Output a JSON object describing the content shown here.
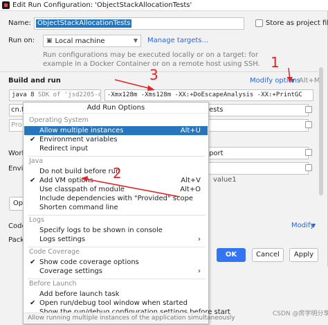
{
  "window": {
    "title": "Edit Run Configuration: 'ObjectStackAllocationTests'",
    "name_label": "Name:",
    "name_value": "ObjectStackAllocationTests",
    "store_label": "Store as project file",
    "run_on_label": "Run on:",
    "run_on_value": "Local machine",
    "manage_targets": "Manage targets...",
    "hint_line1": "Run configurations may be executed locally or on a target: for",
    "hint_line2": "example in a Docker Container or on a remote host using SSH.",
    "build_and_run": "Build and run",
    "modify_options": "Modify options",
    "modify_shortcut": "Alt+M",
    "jre_value": "java 8",
    "jre_grey": " SDK of 'jsd2205-c",
    "vm_options_value": "-Xmx128m -Xms128m -XX:+DoEscapeAnalysis -XX:+PrintGC",
    "main_class_prefix": "cn.t",
    "main_class_tail": "ests",
    "prog_args_prefix": "Pro",
    "working_dir_prefix": "Worki",
    "working_dir_tail": "port",
    "env_prefix": "Envir",
    "env_tail": "value1",
    "op_prefix": "Op",
    "code_label": "Code",
    "modify_link2": "Modify",
    "packa_label": "Packa",
    "ok": "OK",
    "cancel": "Cancel",
    "apply": "Apply"
  },
  "popup": {
    "title": "Add Run Options",
    "groups": [
      {
        "name": "Operating System",
        "items": [
          {
            "label": "Allow multiple instances",
            "shortcut": "Alt+U",
            "checked": false,
            "selected": true
          },
          {
            "label": "Environment variables",
            "shortcut": "",
            "checked": true,
            "selected": false
          },
          {
            "label": "Redirect input",
            "shortcut": "",
            "checked": false,
            "selected": false
          }
        ]
      },
      {
        "name": "Java",
        "items": [
          {
            "label": "Do not build before run",
            "shortcut": "",
            "checked": false,
            "selected": false
          },
          {
            "label": "Add VM options",
            "shortcut": "Alt+V",
            "checked": true,
            "selected": false
          },
          {
            "label": "Use classpath of module",
            "shortcut": "Alt+O",
            "checked": false,
            "selected": false
          },
          {
            "label": "Include dependencies with \"Provided\" scope",
            "shortcut": "",
            "checked": false,
            "selected": false
          },
          {
            "label": "Shorten command line",
            "shortcut": "",
            "checked": false,
            "selected": false
          }
        ]
      },
      {
        "name": "Logs",
        "items": [
          {
            "label": "Specify logs to be shown in console",
            "shortcut": "",
            "checked": false,
            "selected": false
          },
          {
            "label": "Logs settings",
            "shortcut": "",
            "checked": false,
            "selected": false,
            "submenu": true
          }
        ]
      },
      {
        "name": "Code Coverage",
        "items": [
          {
            "label": "Show code coverage options",
            "shortcut": "",
            "checked": true,
            "selected": false
          },
          {
            "label": "Coverage settings",
            "shortcut": "",
            "checked": false,
            "selected": false,
            "submenu": true
          }
        ]
      },
      {
        "name": "Before Launch",
        "items": [
          {
            "label": "Add before launch task",
            "shortcut": "",
            "checked": false,
            "selected": false
          },
          {
            "label": "Open run/debug tool window when started",
            "shortcut": "",
            "checked": true,
            "selected": false
          },
          {
            "label": "Show the run/debug configuration settings before start",
            "shortcut": "",
            "checked": false,
            "selected": false
          }
        ]
      }
    ],
    "footer": "Allow running multiple instances of the application simultaneously"
  },
  "annotations": {
    "one": "1",
    "two": "2",
    "three": "3",
    "color": "#e32323"
  },
  "watermark": "CSDN @房学明分享"
}
